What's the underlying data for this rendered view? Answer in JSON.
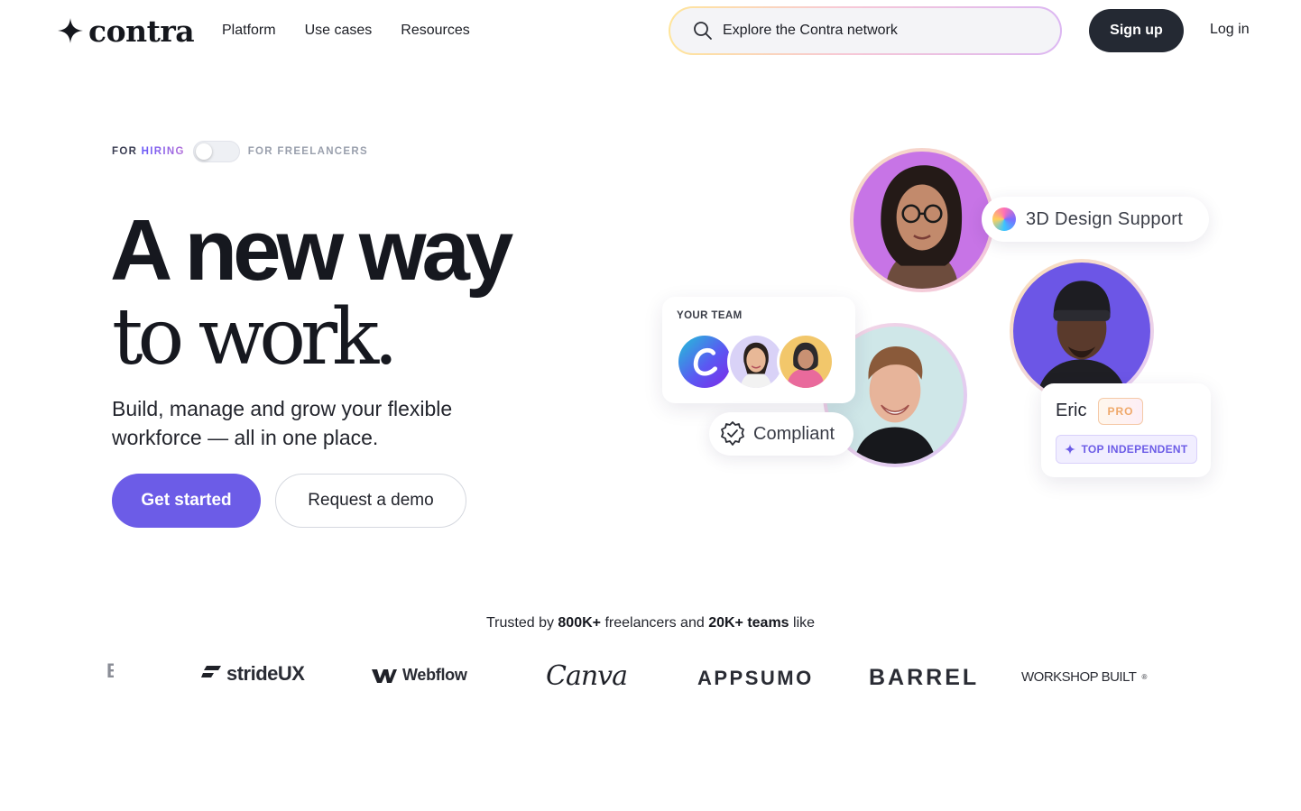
{
  "header": {
    "logo_text": "contra",
    "nav": [
      "Platform",
      "Use cases",
      "Resources"
    ],
    "search_placeholder": "Explore the Contra network",
    "signup_label": "Sign up",
    "login_label": "Log in"
  },
  "hero": {
    "toggle_left_prefix": "FOR ",
    "toggle_left_accent": "HIRING",
    "toggle_right": "FOR FREELANCERS",
    "headline_line1": "A new way",
    "headline_line2": "to work.",
    "subtext": "Build, manage and grow your flexible workforce — all in one place.",
    "primary_cta": "Get started",
    "secondary_cta": "Request a demo"
  },
  "collage": {
    "skill_pill": "3D Design Support",
    "team_card_title": "YOUR TEAM",
    "compliant_label": "Compliant",
    "profile_name": "Eric",
    "pro_badge": "PRO",
    "top_badge": "TOP INDEPENDENT"
  },
  "trusted": {
    "prefix": "Trusted by ",
    "freelancers_count": "800K+",
    "middle": " freelancers and ",
    "teams_count": "20K+ teams",
    "suffix": " like"
  },
  "logos": [
    "strideUX",
    "Webflow",
    "Canva",
    "APPSUMO",
    "BARREL",
    "WORKSHOP BUILT"
  ],
  "colors": {
    "primary": "#6c5ce7",
    "dark_button": "#242933",
    "text": "#16181f"
  }
}
